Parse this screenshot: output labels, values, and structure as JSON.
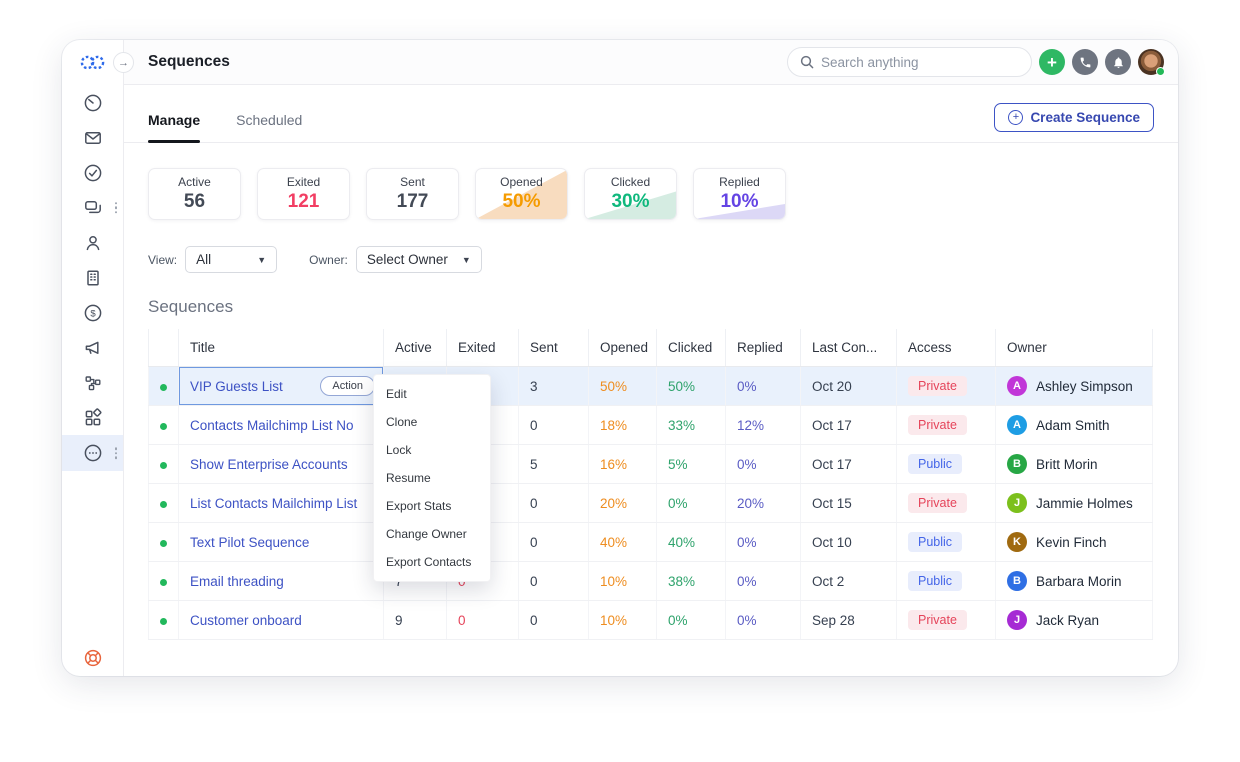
{
  "topbar": {
    "title": "Sequences",
    "search_placeholder": "Search anything",
    "plus_label": "+",
    "collapse_arrow": "→"
  },
  "sidebar": {
    "icons": [
      "dashboard-icon",
      "mail-icon",
      "tasks-icon",
      "chats-icon",
      "contacts-icon",
      "companies-icon",
      "deals-icon",
      "campaigns-icon",
      "workflows-icon",
      "apps-icon",
      "more-icon",
      "help-icon"
    ],
    "active_icon": "more-icon",
    "logo": "brand-logo-linked-circles"
  },
  "tabs": {
    "manage": "Manage",
    "scheduled": "Scheduled"
  },
  "create_button": {
    "label": "Create Sequence"
  },
  "stats": [
    {
      "label": "Active",
      "value": "56",
      "value_color": "#434a56",
      "triangle": null
    },
    {
      "label": "Exited",
      "value": "121",
      "value_color": "#f23e63",
      "triangle": null
    },
    {
      "label": "Sent",
      "value": "177",
      "value_color": "#434a56",
      "triangle": null
    },
    {
      "label": "Opened",
      "value": "50%",
      "value_color": "#f59b00",
      "triangle": {
        "color": "#f8dcbf",
        "cut": "2%"
      }
    },
    {
      "label": "Clicked",
      "value": "30%",
      "value_color": "#0fb87d",
      "triangle": {
        "color": "#d5ece2",
        "cut": "45%"
      }
    },
    {
      "label": "Replied",
      "value": "10%",
      "value_color": "#6444e4",
      "triangle": {
        "color": "#dcd8f6",
        "cut": "70%"
      }
    }
  ],
  "filters": {
    "view_label": "View:",
    "view_value": "All",
    "owner_label": "Owner:",
    "owner_value": "Select Owner",
    "caret": "▼"
  },
  "section_title": "Sequences",
  "table": {
    "columns": [
      "",
      "Title",
      "Active",
      "Exited",
      "Sent",
      "Opened",
      "Clicked",
      "Replied",
      "Last Con...",
      "Access",
      "Owner"
    ],
    "rows": [
      {
        "title": "VIP Guests List",
        "selected": true,
        "action_label": "Action",
        "active": "",
        "exited": "",
        "sent": "3",
        "opened": "50%",
        "clicked": "50%",
        "replied": "0%",
        "last_contacted": "Oct 20",
        "access": "Private",
        "owner": {
          "name": "Ashley Simpson",
          "initial": "A",
          "color": "#c136d8"
        }
      },
      {
        "title": "Contacts Mailchimp List No",
        "active": "",
        "exited": "",
        "sent": "0",
        "opened": "18%",
        "clicked": "33%",
        "replied": "12%",
        "last_contacted": "Oct 17",
        "access": "Private",
        "owner": {
          "name": "Adam Smith",
          "initial": "A",
          "color": "#1e9de4"
        }
      },
      {
        "title": "Show Enterprise Accounts",
        "active": "",
        "exited": "",
        "sent": "5",
        "opened": "16%",
        "clicked": "5%",
        "replied": "0%",
        "last_contacted": "Oct 17",
        "access": "Public",
        "owner": {
          "name": "Britt Morin",
          "initial": "B",
          "color": "#27a745"
        }
      },
      {
        "title": "List Contacts Mailchimp List",
        "active": "",
        "exited": "",
        "sent": "0",
        "opened": "20%",
        "clicked": "0%",
        "replied": "20%",
        "last_contacted": "Oct 15",
        "access": "Private",
        "owner": {
          "name": "Jammie Holmes",
          "initial": "J",
          "color": "#7cc01c"
        }
      },
      {
        "title": "Text Pilot Sequence",
        "active": "",
        "exited": "",
        "sent": "0",
        "opened": "40%",
        "clicked": "40%",
        "replied": "0%",
        "last_contacted": "Oct 10",
        "access": "Public",
        "owner": {
          "name": "Kevin Finch",
          "initial": "K",
          "color": "#a06a10"
        }
      },
      {
        "title": "Email threading",
        "active": "7",
        "exited": "0",
        "sent": "0",
        "opened": "10%",
        "clicked": "38%",
        "replied": "0%",
        "last_contacted": "Oct 2",
        "access": "Public",
        "owner": {
          "name": "Barbara Morin",
          "initial": "B",
          "color": "#2f6fe4"
        }
      },
      {
        "title": "Customer onboard",
        "active": "9",
        "exited": "0",
        "sent": "0",
        "opened": "10%",
        "clicked": "0%",
        "replied": "0%",
        "last_contacted": "Sep 28",
        "access": "Private",
        "owner": {
          "name": "Jack Ryan",
          "initial": "J",
          "color": "#a62bd4"
        }
      }
    ]
  },
  "context_menu": {
    "items": [
      "Edit",
      "Clone",
      "Lock",
      "Resume",
      "Export Stats",
      "Change Owner",
      "Export Contacts"
    ]
  },
  "badges": {
    "Private": {
      "bg": "#fbe9ec",
      "color": "#e5445a"
    },
    "Public": {
      "bg": "#e8edfc",
      "color": "#4465e8"
    }
  },
  "colors": {
    "accent_blue": "#3d53c5",
    "link_blue": "#3d52c4",
    "status_green": "#22b85c",
    "brand_logo_blue": "#2f6bea",
    "help_orange": "#e8643c"
  }
}
